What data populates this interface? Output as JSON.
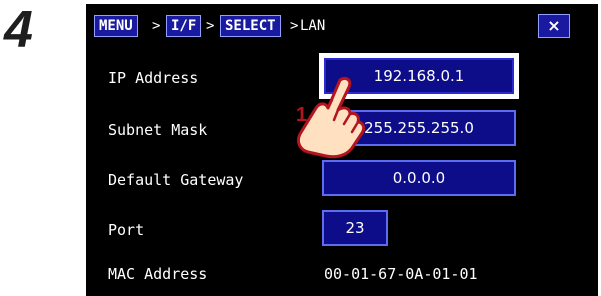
{
  "step": {
    "number": "4"
  },
  "breadcrumb": {
    "items": [
      {
        "label": "MENU"
      },
      {
        "label": "I/F"
      },
      {
        "label": "SELECT"
      },
      {
        "label": "LAN"
      }
    ],
    "separator": ">"
  },
  "close_label": "×",
  "fields": {
    "ip_address": {
      "label": "IP Address",
      "value": "192.168.0.1"
    },
    "subnet_mask": {
      "label": "Subnet Mask",
      "value": "255.255.255.0"
    },
    "default_gateway": {
      "label": "Default Gateway",
      "value": "0.0.0.0"
    },
    "port": {
      "label": "Port",
      "value": "23"
    },
    "mac_address": {
      "label": "MAC Address",
      "value": "00-01-67-0A-01-01"
    }
  },
  "annotation": {
    "marker": "1"
  },
  "colors": {
    "screen_bg": "#000000",
    "field_bg": "#0d0d8a",
    "field_border": "#5d6cf0",
    "marker_red": "#b3141e"
  }
}
